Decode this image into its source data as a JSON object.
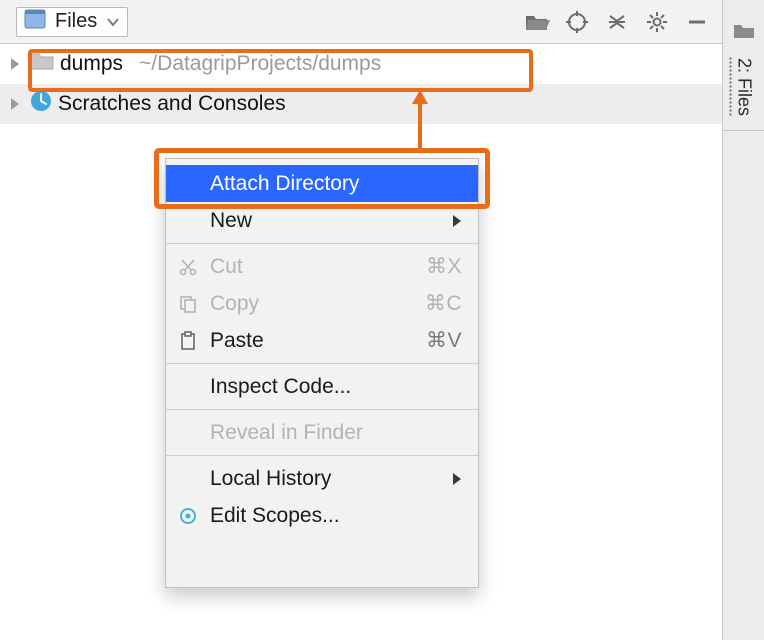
{
  "toolbar": {
    "selector_label": "Files"
  },
  "tree": {
    "dumps": {
      "label": "dumps",
      "path": "~/DatagripProjects/dumps"
    },
    "scratches": {
      "label": "Scratches and Consoles"
    }
  },
  "context": {
    "attach": "Attach Directory",
    "new": "New",
    "cut": "Cut",
    "cut_sc": "⌘X",
    "copy": "Copy",
    "copy_sc": "⌘C",
    "paste": "Paste",
    "paste_sc": "⌘V",
    "inspect": "Inspect Code...",
    "reveal": "Reveal in Finder",
    "localhist": "Local History",
    "editscopes": "Edit Scopes..."
  },
  "right": {
    "tab_label": "2: Files"
  },
  "colors": {
    "accent": "#e86c1a",
    "highlight": "#2a66ff"
  }
}
